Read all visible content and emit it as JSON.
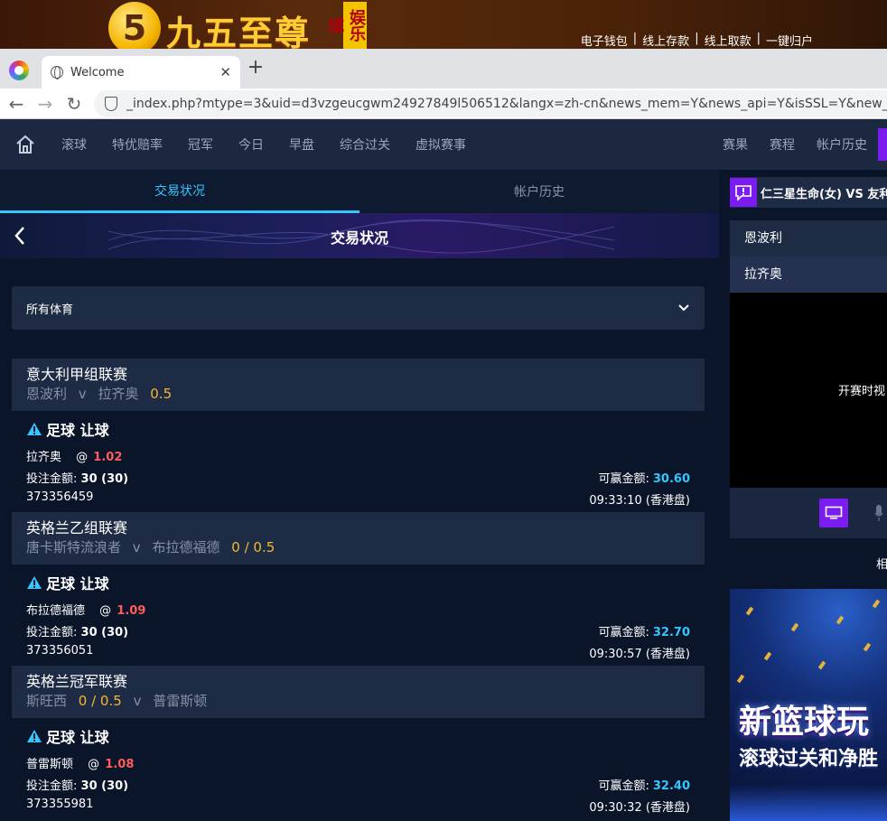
{
  "banner": {
    "logo_numeral": "5",
    "logo_text": "九五至尊",
    "logo_tag": "娱乐城",
    "links": [
      "电子钱包",
      "线上存款",
      "线上取款",
      "一键归户"
    ]
  },
  "browser": {
    "tab_title": "Welcome",
    "url": "_index.php?mtype=3&uid=d3vzgeucgwm24927849l506512&langx=zh-cn&news_mem=Y&news_api=Y&isSSL=Y&new_site=Y&"
  },
  "nav": {
    "items": [
      "滚球",
      "特优赔率",
      "冠军",
      "今日",
      "早盘",
      "综合过关",
      "虚拟赛事"
    ],
    "right_items": [
      "赛果",
      "赛程",
      "帐户历史"
    ]
  },
  "subtabs": [
    "交易状况",
    "帐户历史"
  ],
  "page_title": "交易状况",
  "sport_filter": "所有体育",
  "bets": [
    {
      "league": "意大利甲组联赛",
      "home": "恩波利",
      "v": "v",
      "away": "拉齐奥",
      "handicap": "0.5",
      "type": "足球 让球",
      "pick": "拉齐奥",
      "at": "@",
      "odds": "1.02",
      "stake_label": "投注金额:",
      "stake": "30 (30)",
      "win_label": "可赢金额:",
      "win": "30.60",
      "ticket": "373356459",
      "time": "09:33:10 (香港盘)"
    },
    {
      "league": "英格兰乙组联赛",
      "home": "唐卡斯特流浪者",
      "v": "v",
      "away": "布拉德福德",
      "handicap": "0 / 0.5",
      "type": "足球 让球",
      "pick": "布拉德福德",
      "at": "@",
      "odds": "1.09",
      "stake_label": "投注金额:",
      "stake": "30 (30)",
      "win_label": "可赢金额:",
      "win": "32.70",
      "ticket": "373356051",
      "time": "09:30:57 (香港盘)"
    },
    {
      "league": "英格兰冠军联赛",
      "home": "斯旺西",
      "home_handicap": "0 / 0.5",
      "v": "v",
      "away": "普雷斯顿",
      "type": "足球 让球",
      "pick": "普雷斯顿",
      "at": "@",
      "odds": "1.08",
      "stake_label": "投注金额:",
      "stake": "30 (30)",
      "win_label": "可赢金额:",
      "win": "32.40",
      "ticket": "373355981",
      "time": "09:30:32 (香港盘)"
    }
  ],
  "right_panel": {
    "match_title": "仁三星生命(女) VS 友利",
    "team1": "恩波利",
    "team2": "拉齐奥",
    "video_text": "开赛时视",
    "small_label": "相",
    "promo_line1": "新篮球玩",
    "promo_line2": "滚球过关和净胜"
  },
  "colors": {
    "accent_blue": "#35c6ff",
    "odds_red": "#ff5c5c",
    "handicap_yellow": "#f5b731",
    "purple": "#7a1cf0"
  }
}
